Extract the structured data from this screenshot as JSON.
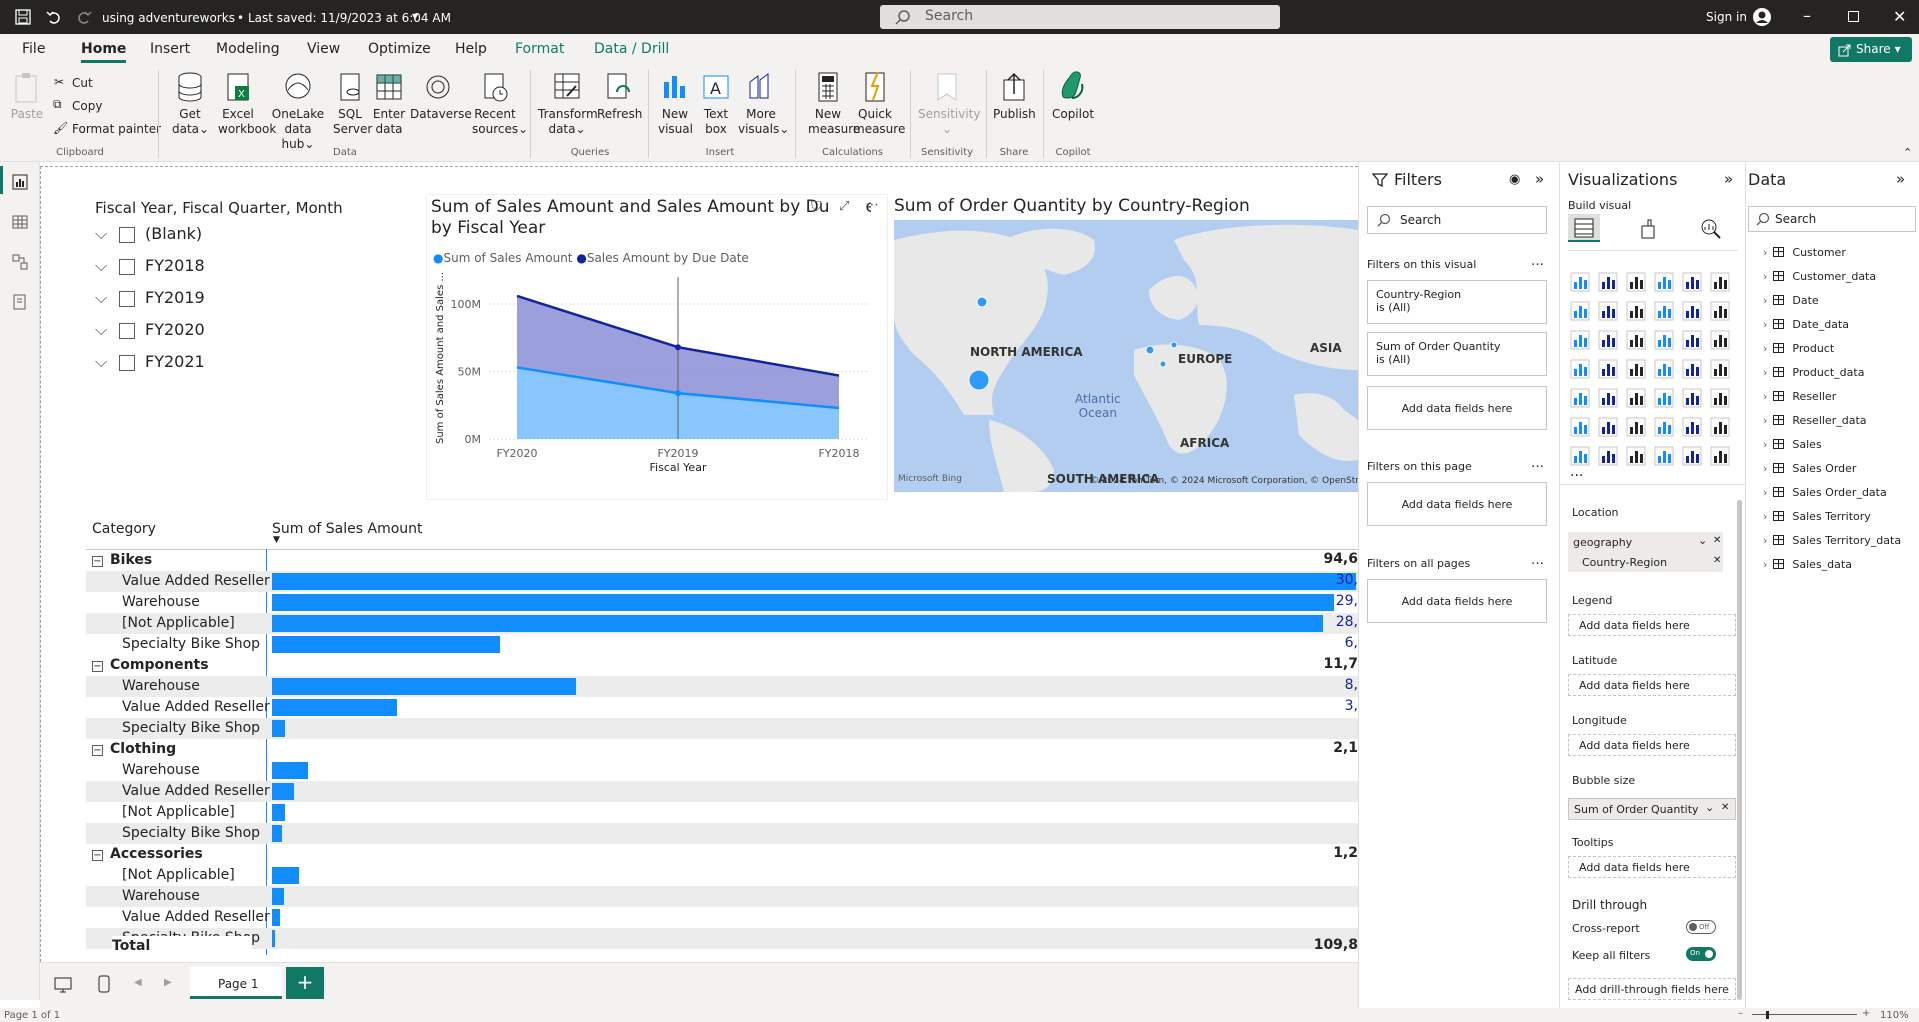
{
  "titlebar": {
    "file_title": "using adventureworks",
    "last_saved": "Last saved: 11/9/2023 at 6:04 AM",
    "search_placeholder": "Search",
    "sign_in": "Sign in"
  },
  "tabs": [
    "File",
    "Home",
    "Insert",
    "Modeling",
    "View",
    "Optimize",
    "Help",
    "Format",
    "Data / Drill"
  ],
  "active_tab": "Home",
  "share_label": "Share",
  "ribbon": {
    "clipboard": {
      "paste": "Paste",
      "cut": "Cut",
      "copy": "Copy",
      "format_painter": "Format painter",
      "group": "Clipboard"
    },
    "data": {
      "get_data_1": "Get",
      "get_data_2": "data",
      "excel_1": "Excel",
      "excel_2": "workbook",
      "onelake_1": "OneLake",
      "onelake_2": "data hub",
      "sql_1": "SQL",
      "sql_2": "Server",
      "enter_1": "Enter",
      "enter_2": "data",
      "dataverse": "Dataverse",
      "recent_1": "Recent",
      "recent_2": "sources",
      "group": "Data"
    },
    "queries": {
      "transform_1": "Transform",
      "transform_2": "data",
      "refresh": "Refresh",
      "group": "Queries"
    },
    "insert": {
      "new_visual_1": "New",
      "new_visual_2": "visual",
      "textbox_1": "Text",
      "textbox_2": "box",
      "more_1": "More",
      "more_2": "visuals",
      "group": "Insert"
    },
    "calculations": {
      "new_measure_1": "New",
      "new_measure_2": "measure",
      "quick_1": "Quick",
      "quick_2": "measure",
      "group": "Calculations"
    },
    "sensitivity": {
      "label": "Sensitivity",
      "group": "Sensitivity"
    },
    "share": {
      "publish": "Publish",
      "group": "Share"
    },
    "copilot": {
      "label": "Copilot",
      "group": "Copilot"
    }
  },
  "slicer": {
    "title": "Fiscal Year, Fiscal Quarter, Month",
    "items": [
      "(Blank)",
      "FY2018",
      "FY2019",
      "FY2020",
      "FY2021"
    ]
  },
  "line_chart_text": {
    "title_line1": "Sum of Sales Amount and Sales Amount by Du",
    "title_line1_tail": "e",
    "title_line2": "by Fiscal Year",
    "legend1": "Sum of Sales Amount",
    "legend2": "Sales Amount by Due Date",
    "ylabel": "Sum of Sales Amount and Sales ...",
    "xlabel": "Fiscal Year"
  },
  "chart_data": {
    "type": "area",
    "title": "Sum of Sales Amount and Sales Amount by Due Date by Fiscal Year",
    "xlabel": "Fiscal Year",
    "ylabel": "Sum of Sales Amount and Sales ...",
    "categories": [
      "FY2020",
      "FY2019",
      "FY2018"
    ],
    "series": [
      {
        "name": "Sum of Sales Amount",
        "values": [
          53,
          34,
          23
        ],
        "color": "#118dff"
      },
      {
        "name": "Sales Amount by Due Date",
        "values": [
          106,
          68,
          47
        ],
        "color": "#12239e"
      }
    ],
    "yticks": [
      "0M",
      "50M",
      "100M"
    ],
    "ylim": [
      0,
      120
    ],
    "grid": true,
    "legend": "top-left"
  },
  "map": {
    "title": "Sum of Order Quantity by Country-Region",
    "labels": {
      "north_america": "NORTH AMERICA",
      "europe": "EUROPE",
      "asia": "ASIA",
      "africa": "AFRICA",
      "south_america": "SOUTH AMERICA",
      "ocean1": "Atlantic",
      "ocean2": "Ocean"
    },
    "bing": "Microsoft Bing",
    "copyright": "© 2024 TomTom, © 2024 Microsoft Corporation, © OpenStreetMap"
  },
  "matrix": {
    "col_category": "Category",
    "col_sales": "Sum of Sales Amount",
    "groups": [
      {
        "name": "Bikes",
        "total": "94,6",
        "rows": [
          {
            "label": "Value Added Reseller",
            "value": "30,",
            "frac": 1.0
          },
          {
            "label": "Warehouse",
            "value": "29,",
            "frac": 0.98
          },
          {
            "label": "[Not Applicable]",
            "value": "28,",
            "frac": 0.97
          },
          {
            "label": "Specialty Bike Shop",
            "value": "6,",
            "frac": 0.21
          }
        ]
      },
      {
        "name": "Components",
        "total": "11,7",
        "rows": [
          {
            "label": "Warehouse",
            "value": "8,",
            "frac": 0.28
          },
          {
            "label": "Value Added Reseller",
            "value": "3,",
            "frac": 0.115
          },
          {
            "label": "Specialty Bike Shop",
            "value": "",
            "frac": 0.012
          }
        ]
      },
      {
        "name": "Clothing",
        "total": "2,1",
        "rows": [
          {
            "label": "Warehouse",
            "value": "",
            "frac": 0.033
          },
          {
            "label": "Value Added Reseller",
            "value": "",
            "frac": 0.02
          },
          {
            "label": "[Not Applicable]",
            "value": "",
            "frac": 0.012
          },
          {
            "label": "Specialty Bike Shop",
            "value": "",
            "frac": 0.009
          }
        ]
      },
      {
        "name": "Accessories",
        "total": "1,2",
        "rows": [
          {
            "label": "[Not Applicable]",
            "value": "",
            "frac": 0.025
          },
          {
            "label": "Warehouse",
            "value": "",
            "frac": 0.011
          },
          {
            "label": "Value Added Reseller",
            "value": "",
            "frac": 0.007
          },
          {
            "label": "Specialty Bike Shop",
            "value": "",
            "frac": 0.003
          }
        ]
      }
    ],
    "total_label": "Total",
    "total_value": "109,8"
  },
  "filters": {
    "title": "Filters",
    "search": "Search",
    "on_visual": "Filters on this visual",
    "card1_line1": "Country-Region",
    "card1_line2": "is (All)",
    "card2_line1": "Sum of Order Quantity",
    "card2_line2": "is (All)",
    "add": "Add data fields here",
    "on_page": "Filters on this page",
    "on_all": "Filters on all pages"
  },
  "visualizations": {
    "title": "Visualizations",
    "build": "Build visual",
    "location": "Location",
    "geo1": "geography",
    "geo2": "Country-Region",
    "legend": "Legend",
    "latitude": "Latitude",
    "longitude": "Longitude",
    "bubble": "Bubble size",
    "bubble_val": "Sum of Order Quantity",
    "tooltips": "Tooltips",
    "add": "Add data fields here",
    "drill": "Drill through",
    "cross": "Cross-report",
    "off": "Off",
    "keep": "Keep all filters",
    "on": "On",
    "add_drill": "Add drill-through fields here",
    "more": "..."
  },
  "data_pane": {
    "title": "Data",
    "search": "Search",
    "tables": [
      "Customer",
      "Customer_data",
      "Date",
      "Date_data",
      "Product",
      "Product_data",
      "Reseller",
      "Reseller_data",
      "Sales",
      "Sales Order",
      "Sales Order_data",
      "Sales Territory",
      "Sales Territory_data",
      "Sales_data"
    ]
  },
  "pagebar": {
    "page": "Page 1"
  },
  "status": {
    "page": "Page 1 of 1",
    "zoom": "110%"
  }
}
